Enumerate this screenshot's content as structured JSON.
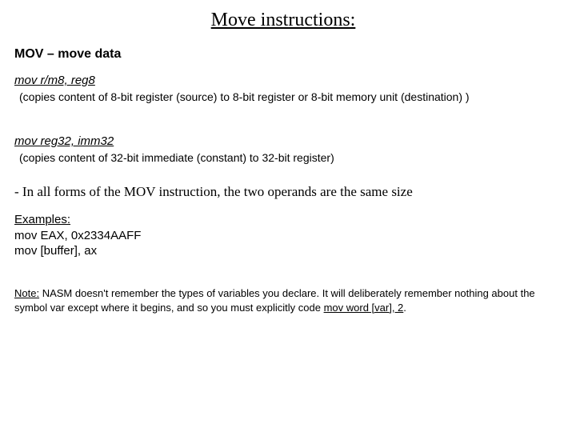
{
  "title": "Move instructions:",
  "heading": "MOV – move data",
  "form1": {
    "syntax": "mov r/m8, reg8",
    "desc": "(copies content of 8-bit register (source) to 8-bit register or 8-bit memory unit (destination) )"
  },
  "form2": {
    "syntax": "mov reg32, imm32",
    "desc": "(copies content of 32-bit immediate (constant) to 32-bit register)"
  },
  "rule": "- In all forms of the MOV instruction, the two operands are the same size",
  "examples": {
    "label": "Examples:",
    "line1": "mov EAX, 0x2334AAFF",
    "line2": "mov [buffer], ax"
  },
  "note": {
    "label": "Note:",
    "body": " NASM doesn't remember the types of variables you declare. It will deliberately remember nothing about the symbol var except where it begins, and so you must explicitly code ",
    "code": "mov word [var], 2",
    "tail": "."
  }
}
